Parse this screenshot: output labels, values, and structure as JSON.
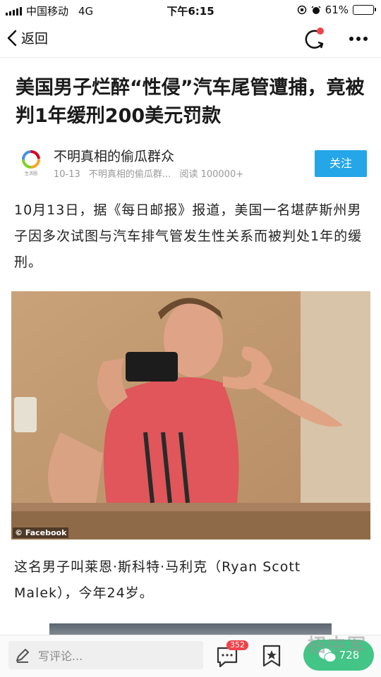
{
  "status_bar": {
    "carrier": "中国移动",
    "network": "4G",
    "time": "下午6:15",
    "battery": "61%",
    "battery_level": 0.61
  },
  "nav": {
    "back_label": "返回",
    "refresh_icon": "refresh-icon",
    "more_icon": "more-dots-icon"
  },
  "article": {
    "title": "美国男子烂醉“性侵”汽车尾管遭捕，竟被判1年缓刑200美元罚款",
    "author": {
      "name": "不明真相的偷瓜群众",
      "logo_text": "生活圈",
      "date": "10-13",
      "source": "不明真相的偷瓜群...",
      "reads": "阅读 100000+",
      "follow_label": "关注"
    },
    "paragraph1": "10月13日，据《每日邮报》报道，美国一名堪萨斯州男子因多次试图与汽车排气管发生性关系而被判处1年的缓刑。",
    "photo_caption": "© Facebook",
    "paragraph2": "这名男子叫莱恩·斯科特·马利克（Ryan Scott Malek），今年24岁。"
  },
  "bottom_bar": {
    "comment_placeholder": "写评论...",
    "comment_count": "352",
    "share_count": "728",
    "watermark": "招中军"
  },
  "colors": {
    "follow_button": "#24a6e8",
    "badge": "#f0424a",
    "share_button": "#2fc07a"
  }
}
